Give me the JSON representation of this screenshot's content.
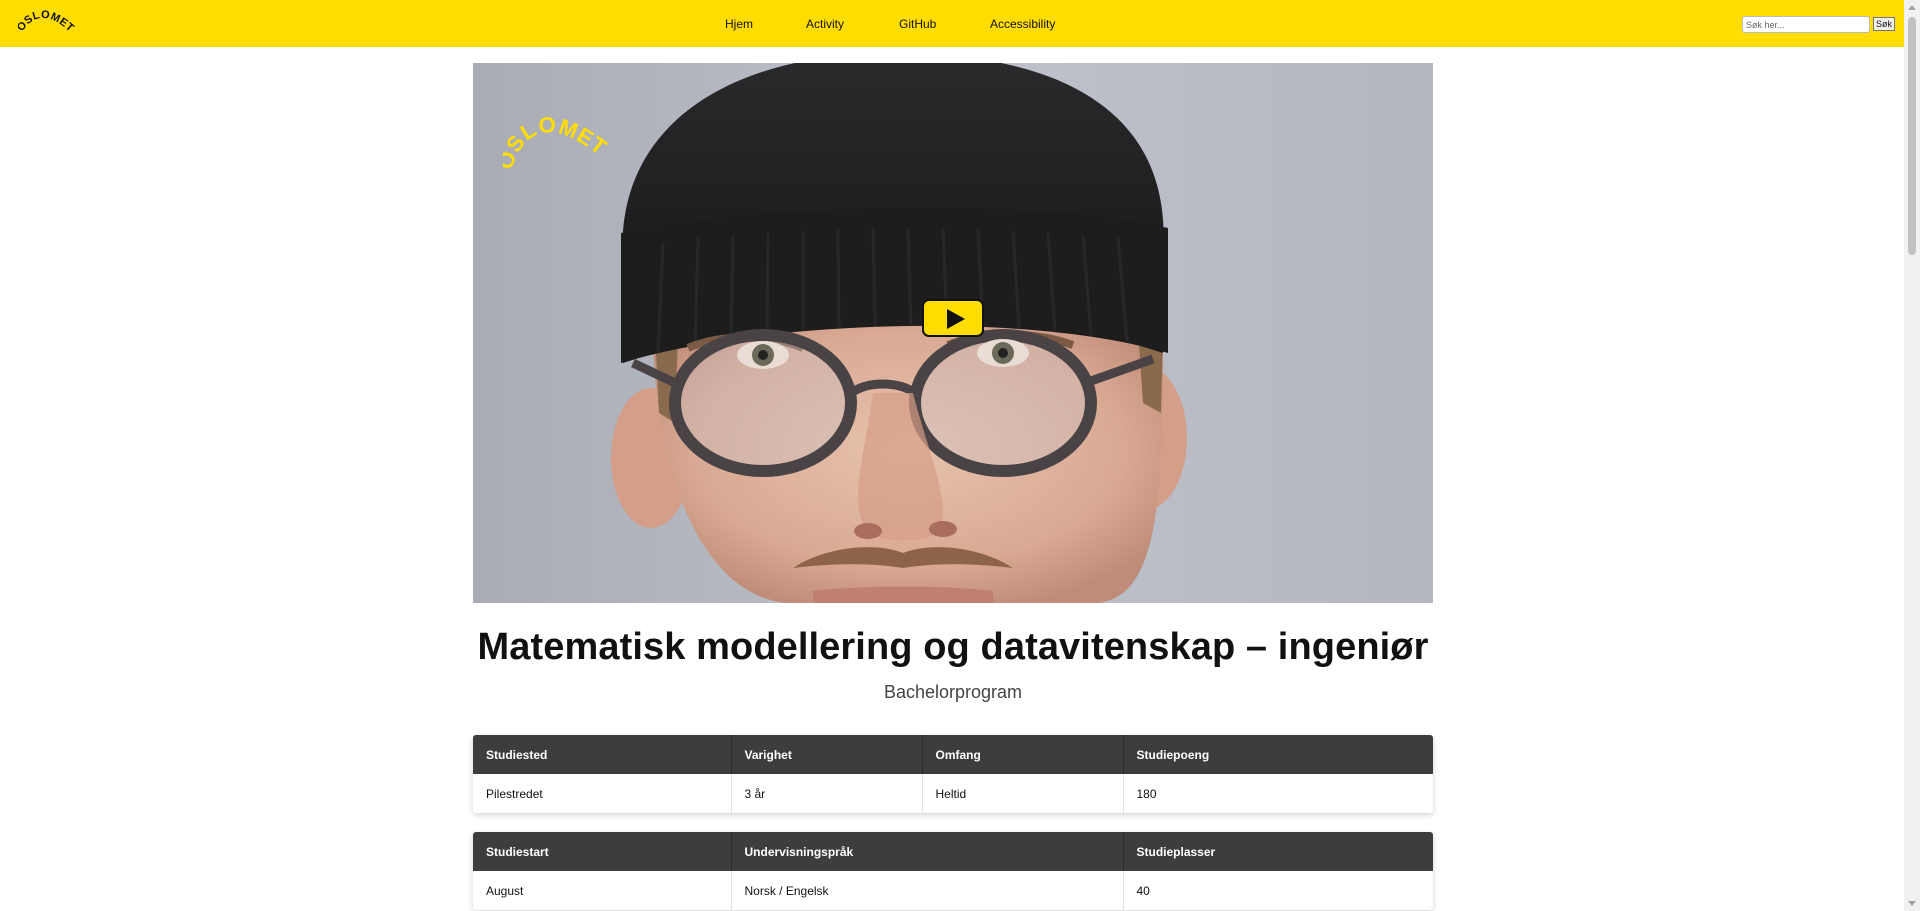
{
  "header": {
    "logo_text": "OSLOMET",
    "nav": [
      {
        "label": "Hjem"
      },
      {
        "label": "Activity"
      },
      {
        "label": "GitHub"
      },
      {
        "label": "Accessibility"
      }
    ],
    "search": {
      "placeholder": "Søk her...",
      "button_label": "Søk"
    }
  },
  "video": {
    "logo_text": "OSLOMET",
    "play_icon": "play-icon"
  },
  "program": {
    "title": "Matematisk modellering og datavitenskap – ingeniør",
    "subtitle": "Bachelorprogram"
  },
  "table1": {
    "headers": [
      "Studiested",
      "Varighet",
      "Omfang",
      "Studiepoeng"
    ],
    "values": [
      "Pilestredet",
      "3 år",
      "Heltid",
      "180"
    ]
  },
  "table2": {
    "headers": [
      "Studiestart",
      "Undervisningspråk",
      "Studieplasser"
    ],
    "values": [
      "August",
      "Norsk / Engelsk",
      "40"
    ]
  },
  "colors": {
    "accent": "#ffdd00",
    "table_header": "#3d3d3d"
  }
}
